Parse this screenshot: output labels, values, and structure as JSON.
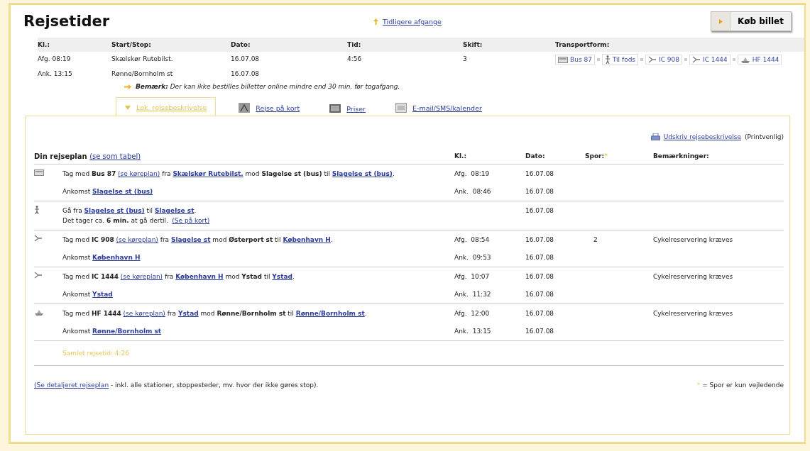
{
  "title": "Rejsetider",
  "earlier_link": "Tidligere afgange",
  "buy_button": "Køb billet",
  "summary": {
    "columns": [
      "Kl.:",
      "Start/Stop:",
      "Dato:",
      "Tid:",
      "Skift:",
      "Transportform:"
    ],
    "rows": [
      {
        "clock": "Afg.  08:19",
        "place": "Skælskør Rutebilst.",
        "date": "16.07.08",
        "time": "4:56",
        "changes": "3"
      },
      {
        "clock": "Ank.  13:15",
        "place": "Rønne/Bornholm st",
        "date": "16.07.08"
      }
    ],
    "transport": [
      {
        "kind": "bus",
        "label": "Bus 87"
      },
      {
        "kind": "walk",
        "label": "Til fods"
      },
      {
        "kind": "train",
        "label": "IC 908"
      },
      {
        "kind": "train",
        "label": "IC 1444"
      },
      {
        "kind": "ship",
        "label": "HF 1444"
      }
    ],
    "remark": "**Bemærk:** Der kan ikke bestilles billetter online mindre end 30 min. før togafgang."
  },
  "tabs": [
    {
      "label": "Lok. rejsebeskrivelse",
      "kind": "caret",
      "selected": true
    },
    {
      "label": "Rejse på kort",
      "kind": "map",
      "selected": false
    },
    {
      "label": "Priser",
      "kind": "table",
      "selected": false
    },
    {
      "label": "E-mail/SMS/kalender",
      "kind": "mail",
      "selected": false
    }
  ],
  "print_link": "Udskriv rejsebeskrivelse",
  "print_note": "(Printvenlig)",
  "plan": {
    "title": "Din rejseplan",
    "table_link": "(se som tabel)",
    "columns": [
      "Kl.:",
      "Dato:",
      "Spor:",
      "Bemærkninger:"
    ],
    "spor_mark": "*",
    "legs": [
      {
        "kind": "bus",
        "rows": [
          {
            "segments": [
              {
                "kind": "text",
                "text": "Tag med "
              },
              {
                "kind": "bold",
                "text": "Bus 87"
              },
              {
                "kind": "schedule",
                "text": "(se køreplan)"
              },
              {
                "kind": "text",
                "text": " fra "
              },
              {
                "kind": "link",
                "text": "Skælskør Rutebilst."
              },
              {
                "kind": "text",
                "text": " mod "
              },
              {
                "kind": "bold",
                "text": "Slagelse st (bus)"
              },
              {
                "kind": "text",
                "text": " til "
              },
              {
                "kind": "link",
                "text": "Slagelse st (bus)"
              },
              {
                "kind": "text",
                "text": "."
              }
            ],
            "clock": "Afg.  08:19",
            "date": "16.07.08"
          },
          {
            "segments": [
              {
                "kind": "text",
                "text": "Ankomst "
              },
              {
                "kind": "link",
                "text": "Slagelse st (bus)"
              }
            ],
            "clock": "Ank.  08:46",
            "date": "16.07.08"
          }
        ]
      },
      {
        "kind": "walk",
        "rows": [
          {
            "segments": [
              {
                "kind": "text",
                "text": "Gå fra "
              },
              {
                "kind": "link",
                "text": "Slagelse st (bus)"
              },
              {
                "kind": "text",
                "text": " til "
              },
              {
                "kind": "link",
                "text": "Slagelse st"
              },
              {
                "kind": "text",
                "text": "."
              },
              {
                "kind": "break"
              },
              {
                "kind": "text",
                "text": "Det tager ca. "
              },
              {
                "kind": "bold",
                "text": "6 min."
              },
              {
                "kind": "text",
                "text": " at gå dertil. "
              },
              {
                "kind": "schedule",
                "text": "(Se på kort)"
              }
            ],
            "date": "16.07.08"
          }
        ]
      },
      {
        "kind": "train",
        "rows": [
          {
            "segments": [
              {
                "kind": "text",
                "text": "Tag med "
              },
              {
                "kind": "bold",
                "text": "IC 908"
              },
              {
                "kind": "schedule",
                "text": "(se køreplan)"
              },
              {
                "kind": "text",
                "text": " fra "
              },
              {
                "kind": "link",
                "text": "Slagelse st"
              },
              {
                "kind": "text",
                "text": " mod "
              },
              {
                "kind": "bold",
                "text": "Østerport st"
              },
              {
                "kind": "text",
                "text": " til "
              },
              {
                "kind": "link",
                "text": "København H"
              },
              {
                "kind": "text",
                "text": "."
              }
            ],
            "clock": "Afg.  08:54",
            "date": "16.07.08",
            "spor": "2",
            "remark": "Cykelreservering kræves"
          },
          {
            "segments": [
              {
                "kind": "text",
                "text": "Ankomst "
              },
              {
                "kind": "link",
                "text": "København H"
              }
            ],
            "clock": "Ank.  09:53",
            "date": "16.07.08"
          }
        ]
      },
      {
        "kind": "train",
        "rows": [
          {
            "segments": [
              {
                "kind": "text",
                "text": "Tag med "
              },
              {
                "kind": "bold",
                "text": "IC 1444"
              },
              {
                "kind": "schedule",
                "text": "(se køreplan)"
              },
              {
                "kind": "text",
                "text": " fra "
              },
              {
                "kind": "link",
                "text": "København H"
              },
              {
                "kind": "text",
                "text": " mod "
              },
              {
                "kind": "bold",
                "text": "Ystad"
              },
              {
                "kind": "text",
                "text": " til "
              },
              {
                "kind": "link",
                "text": "Ystad"
              },
              {
                "kind": "text",
                "text": "."
              }
            ],
            "clock": "Afg.  10:07",
            "date": "16.07.08",
            "remark": "Cykelreservering kræves"
          },
          {
            "segments": [
              {
                "kind": "text",
                "text": "Ankomst "
              },
              {
                "kind": "link",
                "text": "Ystad"
              }
            ],
            "clock": "Ank.  11:32",
            "date": "16.07.08"
          }
        ]
      },
      {
        "kind": "ship",
        "rows": [
          {
            "segments": [
              {
                "kind": "text",
                "text": "Tag med "
              },
              {
                "kind": "bold",
                "text": "HF 1444"
              },
              {
                "kind": "schedule",
                "text": "(se køreplan)"
              },
              {
                "kind": "text",
                "text": " fra "
              },
              {
                "kind": "link",
                "text": "Ystad"
              },
              {
                "kind": "text",
                "text": " mod "
              },
              {
                "kind": "bold",
                "text": "Rønne/Bornholm st"
              },
              {
                "kind": "text",
                "text": " til "
              },
              {
                "kind": "link",
                "text": "Rønne/Bornholm st"
              },
              {
                "kind": "text",
                "text": "."
              }
            ],
            "clock": "Afg.  12:00",
            "date": "16.07.08",
            "remark": "Cykelreservering kræves"
          },
          {
            "segments": [
              {
                "kind": "text",
                "text": "Ankomst "
              },
              {
                "kind": "link",
                "text": "Rønne/Bornholm st"
              }
            ],
            "clock": "Ank.  13:15",
            "date": "16.07.08"
          }
        ]
      }
    ],
    "total": "Samlet rejsetid: 4:26"
  },
  "footer": {
    "link": "(Se detaljeret rejseplan",
    "text": " - inkl. alle stationer, stoppesteder, mv. hvor der ikke gøres stop).",
    "mark": "*",
    "note": " = Spor er kun vejledende"
  }
}
